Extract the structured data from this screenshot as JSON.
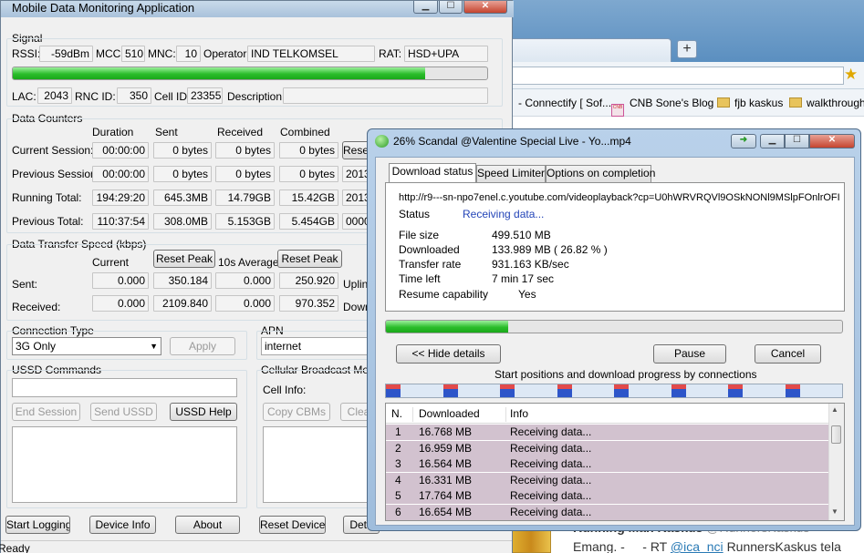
{
  "browser": {
    "bookmarks": [
      "- Connectify [ Sof...",
      "CNB Sone's Blog",
      "fjb kaskus",
      "walkthrough"
    ],
    "favicon_text": "CNB Sone's Blog",
    "feed_title": "Running Man Kaskus",
    "feed_handle": "@RunnersKaskus",
    "feed_line_prefix": "Emang. -",
    "feed_line_rt": "- RT",
    "feed_line_user": "@ica_nci",
    "feed_line_rest": "RunnersKaskus tela",
    "newtab_label": "+"
  },
  "app": {
    "title": "Mobile Data Monitoring Application",
    "signal": {
      "section": "Signal",
      "rssi_label": "RSSI:",
      "rssi": "-59dBm",
      "mcc_label": "MCC:",
      "mcc": "510",
      "mnc_label": "MNC:",
      "mnc": "10",
      "operator_label": "Operator:",
      "operator": "IND TELKOMSEL",
      "rat_label": "RAT:",
      "rat": "HSD+UPA",
      "signal_strength": 0.87,
      "lac_label": "LAC:",
      "lac": "2043",
      "rnc_label": "RNC ID:",
      "rnc": "350",
      "cell_label": "Cell ID:",
      "cell": "23355",
      "desc_label": "Description:",
      "desc": ""
    },
    "counters": {
      "section": "Data Counters",
      "headers": [
        "Duration",
        "Sent",
        "Received",
        "Combined"
      ],
      "rows": [
        {
          "label": "Current Session:",
          "values": [
            "00:00:00",
            "0 bytes",
            "0 bytes",
            "0 bytes"
          ],
          "extra": "Rese"
        },
        {
          "label": "Previous Session:",
          "values": [
            "00:00:00",
            "0 bytes",
            "0 bytes",
            "0 bytes"
          ],
          "extra": "2013"
        },
        {
          "label": "Running Total:",
          "values": [
            "194:29:20",
            "645.3MB",
            "14.79GB",
            "15.42GB"
          ],
          "extra": "2013"
        },
        {
          "label": "Previous Total:",
          "values": [
            "110:37:54",
            "308.0MB",
            "5.153GB",
            "5.454GB"
          ],
          "extra": "0000"
        }
      ]
    },
    "speed": {
      "section": "Data Transfer Speed (kbps)",
      "current_label": "Current",
      "reset1": "Reset Peak",
      "avg_label": "10s Average",
      "reset2": "Reset Peak",
      "sent_label": "Sent:",
      "recv_label": "Received:",
      "sent": [
        "0.000",
        "350.184",
        "0.000",
        "250.920"
      ],
      "recv": [
        "0.000",
        "2109.840",
        "0.000",
        "970.352"
      ],
      "uplink": "Uplink",
      "downlink": "Down"
    },
    "conn_type": {
      "section": "Connection Type",
      "value": "3G Only",
      "apply": "Apply"
    },
    "apn": {
      "section": "APN",
      "value": "internet"
    },
    "ussd": {
      "section": "USSD Commands",
      "end": "End Session",
      "send": "Send USSD",
      "help": "USSD Help"
    },
    "cbm": {
      "section": "Cellular Broadcast Messa",
      "cell_info": "Cell Info:",
      "copy": "Copy CBMs",
      "clear": "Clea"
    },
    "bottom": {
      "start_logging": "Start Logging",
      "device_info": "Device Info",
      "about": "About",
      "reset_device": "Reset Device",
      "detect": "Dete"
    },
    "status": "Ready"
  },
  "download": {
    "title": "26% Scandal @Valentine Special Live - Yo...mp4",
    "tabs": [
      "Download status",
      "Speed Limiter",
      "Options on completion"
    ],
    "url": "http://r9---sn-npo7enel.c.youtube.com/videoplayback?cp=U0hWRVRQVl9OSkNONl9MSlpFOnlrOFI",
    "status_label": "Status",
    "status": "Receiving data...",
    "filesize_label": "File size",
    "filesize": "499.510  MB",
    "downloaded_label": "Downloaded",
    "downloaded": "133.989  MB  ( 26.82 % )",
    "rate_label": "Transfer rate",
    "rate": "931.163  KB/sec",
    "timeleft_label": "Time left",
    "timeleft": "7 min  17 sec",
    "resume_label": "Resume capability",
    "resume": "Yes",
    "progress": 0.2682,
    "hide_details": "<< Hide details",
    "pause": "Pause",
    "cancel": "Cancel",
    "conn_label": "Start positions and download progress by connections",
    "table": {
      "headers": [
        "N.",
        "Downloaded",
        "Info"
      ],
      "rows": [
        {
          "n": "1",
          "downloaded": "16.768  MB",
          "info": "Receiving data..."
        },
        {
          "n": "2",
          "downloaded": "16.959  MB",
          "info": "Receiving data..."
        },
        {
          "n": "3",
          "downloaded": "16.564  MB",
          "info": "Receiving data..."
        },
        {
          "n": "4",
          "downloaded": "16.331  MB",
          "info": "Receiving data..."
        },
        {
          "n": "5",
          "downloaded": "17.764  MB",
          "info": "Receiving data..."
        },
        {
          "n": "6",
          "downloaded": "16.654  MB",
          "info": "Receiving data..."
        }
      ]
    }
  }
}
